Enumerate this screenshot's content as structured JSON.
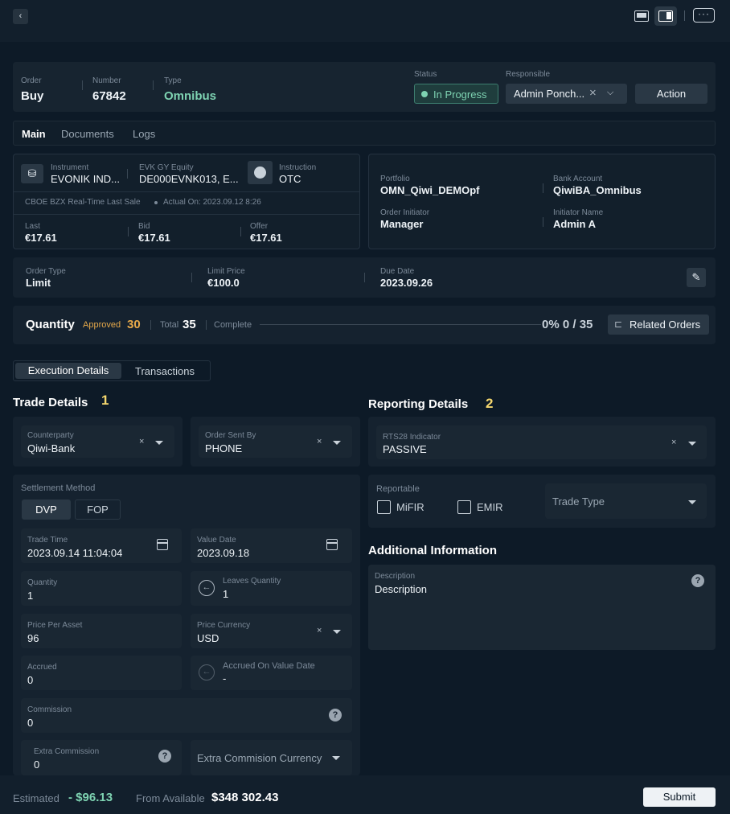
{
  "header": {
    "back_icon": "chevron-left-icon",
    "layout_icons": [
      "single-panel-icon",
      "split-panel-icon"
    ],
    "more_icon": "ellipsis-icon"
  },
  "order": {
    "order_label": "Order",
    "order_value": "Buy",
    "number_label": "Number",
    "number_value": "67842",
    "type_label": "Type",
    "type_value": "Omnibus",
    "status_label": "Status",
    "status_value": "In Progress",
    "responsible_label": "Responsible",
    "responsible_value": "Admin Ponch...",
    "action_label": "Action"
  },
  "tabs": [
    "Main",
    "Documents",
    "Logs"
  ],
  "instrument": {
    "instrument_label": "Instrument",
    "instrument_value": "EVONIK IND...",
    "equity_label": "EVK GY Equity",
    "equity_value": "DE000EVNK013, E...",
    "instruction_label": "Instruction",
    "instruction_value": "OTC",
    "feed": "CBOE BZX Real-Time Last Sale",
    "actual": "Actual On: 2023.09.12 8:26",
    "last_label": "Last",
    "last_value": "€17.61",
    "bid_label": "Bid",
    "bid_value": "€17.61",
    "offer_label": "Offer",
    "offer_value": "€17.61"
  },
  "portfolio": {
    "portfolio_label": "Portfolio",
    "portfolio_value": "OMN_Qiwi_DEMOpf",
    "bank_label": "Bank Account",
    "bank_value": "QiwiBA_Omnibus",
    "initiator_label": "Order Initiator",
    "initiator_value": "Manager",
    "initiator_name_label": "Initiator Name",
    "initiator_name_value": "Admin A"
  },
  "order_type": {
    "type_label": "Order Type",
    "type_value": "Limit",
    "limit_label": "Limit Price",
    "limit_value": "€100.0",
    "due_label": "Due Date",
    "due_value": "2023.09.26"
  },
  "quantity": {
    "title": "Quantity",
    "approved_label": "Approved",
    "approved_value": "30",
    "total_label": "Total",
    "total_value": "35",
    "complete_label": "Complete",
    "progress_text": "0% 0 / 35",
    "progress_fraction": 0,
    "related_label": "Related Orders"
  },
  "subtabs": [
    "Execution Details",
    "Transactions"
  ],
  "trade": {
    "title": "Trade Details",
    "number": "1",
    "counterparty_label": "Counterparty",
    "counterparty_value": "Qiwi-Bank",
    "sent_label": "Order Sent By",
    "sent_value": "PHONE",
    "settlement_label": "Settlement Method",
    "dvp": "DVP",
    "fop": "FOP",
    "trade_time_label": "Trade Time",
    "trade_time_value": "2023.09.14 11:04:04",
    "value_date_label": "Value Date",
    "value_date_value": "2023.09.18",
    "quantity_label": "Quantity",
    "quantity_value": "1",
    "leaves_label": "Leaves Quantity",
    "leaves_value": "1",
    "price_label": "Price Per Asset",
    "price_value": "96",
    "currency_label": "Price Currency",
    "currency_value": "USD",
    "accrued_label": "Accrued",
    "accrued_value": "0",
    "accrued_vd_label": "Accrued On Value Date",
    "accrued_vd_value": "-",
    "commission_label": "Commission",
    "commission_value": "0",
    "extra_label": "Extra Commission",
    "extra_value": "0",
    "extra_currency_placeholder": "Extra Commision Currency"
  },
  "reporting": {
    "title": "Reporting Details",
    "number": "2",
    "rts_label": "RTS28 Indicator",
    "rts_value": "PASSIVE",
    "reportable_label": "Reportable",
    "mifir": "MiFIR",
    "emir": "EMIR",
    "trade_type_placeholder": "Trade Type"
  },
  "additional": {
    "title": "Additional Information",
    "desc_label": "Description",
    "desc_value": "Description"
  },
  "footer": {
    "estimated_label": "Estimated",
    "estimated_value": "- $96.13",
    "available_label": "From Available",
    "available_value": "$348 302.43",
    "submit_label": "Submit"
  },
  "colors": {
    "accent_green": "#7ed3b2",
    "accent_yellow": "#f5d76e",
    "approved_orange": "#e6a94a"
  }
}
